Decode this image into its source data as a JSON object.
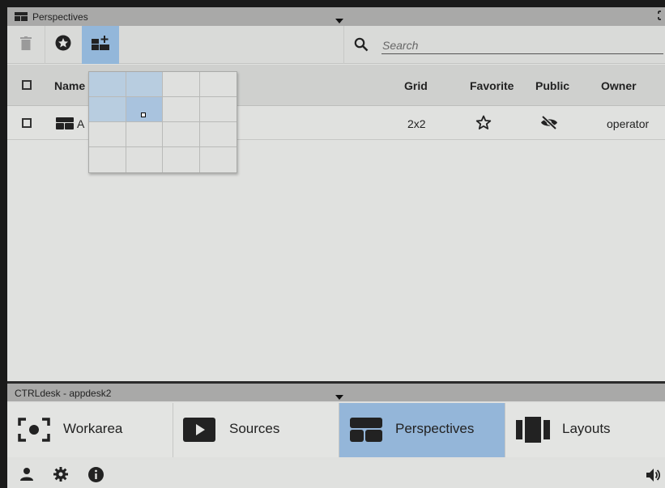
{
  "top_panel": {
    "title": "Perspectives"
  },
  "toolbar": {
    "search_placeholder": "Search"
  },
  "table": {
    "columns": {
      "name": "Name",
      "grid": "Grid",
      "favorite": "Favorite",
      "public": "Public",
      "owner": "Owner"
    },
    "rows": [
      {
        "name_partial": "A",
        "grid": "2x2",
        "owner": "operator"
      }
    ]
  },
  "grid_picker": {
    "cols": 4,
    "rows": 4,
    "selected_cols": 2,
    "selected_rows": 2
  },
  "bottom_panel": {
    "title": "CTRLdesk - appdesk2",
    "nav": [
      {
        "label": "Workarea"
      },
      {
        "label": "Sources"
      },
      {
        "label": "Perspectives"
      },
      {
        "label": "Layouts"
      }
    ]
  },
  "colors": {
    "accent": "#94b6d9",
    "titlebar": "#a9a9a8",
    "background": "#e0e1df"
  }
}
